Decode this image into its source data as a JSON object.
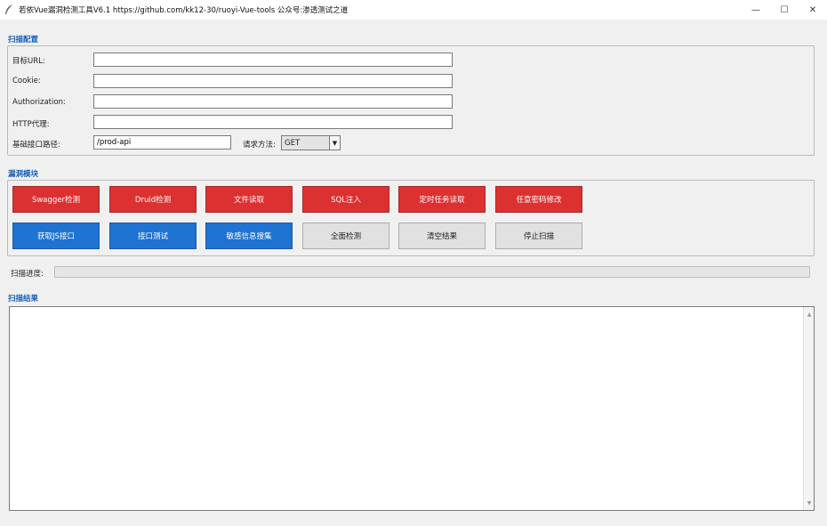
{
  "window": {
    "title": "若依Vue漏洞检测工具V6.1    https://github.com/kk12-30/ruoyi-Vue-tools    公众号:渗透测试之道",
    "minimize": "—",
    "maximize": "☐",
    "close": "✕"
  },
  "scan_config": {
    "section_title": "扫描配置",
    "target_url_label": "目标URL:",
    "target_url_value": "",
    "cookie_label": "Cookie:",
    "cookie_value": "",
    "authorization_label": "Authorization:",
    "authorization_value": "",
    "http_proxy_label": "HTTP代理:",
    "http_proxy_value": "",
    "base_path_label": "基础接口路径:",
    "base_path_value": "/prod-api",
    "method_label": "请求方法:",
    "method_value": "GET"
  },
  "vuln_modules": {
    "section_title": "漏洞模块",
    "row1": [
      "Swagger检测",
      "Druid检测",
      "文件读取",
      "SQL注入",
      "定时任务读取",
      "任意密码修改"
    ],
    "row2": [
      "获取JS接口",
      "接口测试",
      "敏感信息搜集",
      "全面检测",
      "清空结果",
      "停止扫描"
    ]
  },
  "progress": {
    "label": "扫描进度:",
    "value": 0
  },
  "results": {
    "section_title": "扫描结果",
    "content": ""
  },
  "colors": {
    "red": "#dc3131",
    "blue": "#1f73d1",
    "gray": "#e1e1e1",
    "section_title": "#1a5fb4"
  }
}
